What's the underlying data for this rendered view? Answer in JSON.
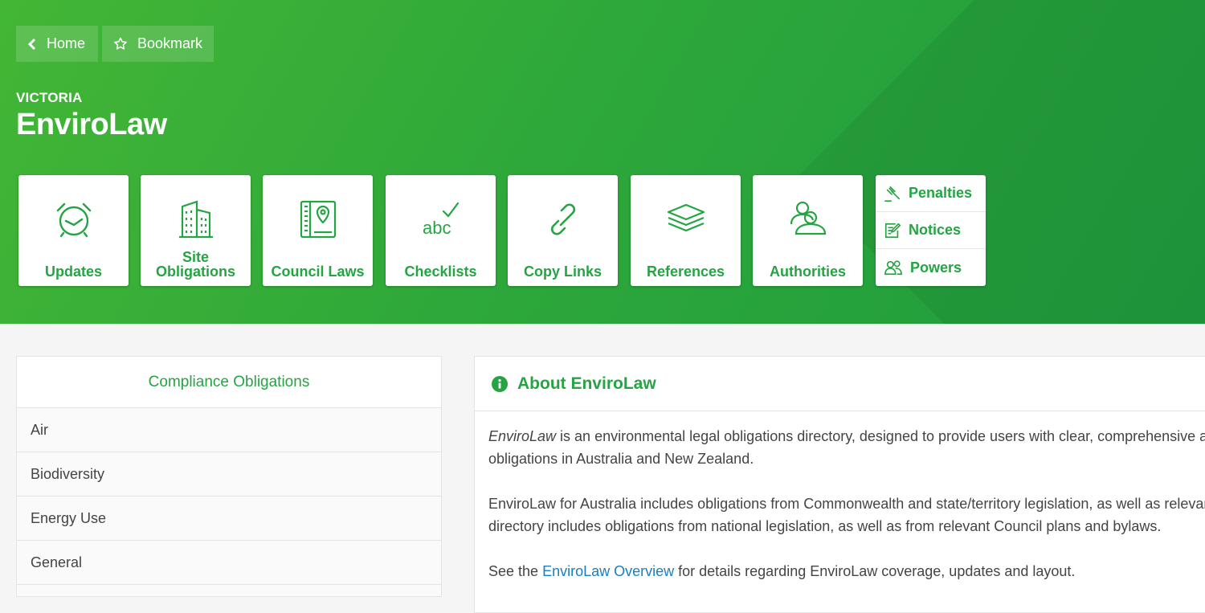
{
  "nav": {
    "home_label": "Home",
    "bookmark_label": "Bookmark"
  },
  "header": {
    "region": "VICTORIA",
    "title": "EnviroLaw"
  },
  "tiles": [
    {
      "label": "Updates",
      "icon": "alarm-clock-icon"
    },
    {
      "label": "Site\nObligations",
      "icon": "building-icon"
    },
    {
      "label": "Council Laws",
      "icon": "map-book-icon"
    },
    {
      "label": "Checklists",
      "icon": "abc-check-icon"
    },
    {
      "label": "Copy Links",
      "icon": "link-icon"
    },
    {
      "label": "References",
      "icon": "layers-icon"
    },
    {
      "label": "Authorities",
      "icon": "people-icon"
    }
  ],
  "mini_tiles": [
    {
      "label": "Penalties",
      "icon": "gavel-icon"
    },
    {
      "label": "Notices",
      "icon": "notice-edit-icon"
    },
    {
      "label": "Powers",
      "icon": "users-icon"
    }
  ],
  "obligations": {
    "title": "Compliance Obligations",
    "items": [
      "Air",
      "Biodiversity",
      "Energy Use",
      "General"
    ]
  },
  "about": {
    "title": "About EnviroLaw",
    "p1_em": "EnviroLaw",
    "p1_line1": " is an environmental legal obligations directory, designed to provide users with clear, comprehensive and",
    "p1_line2": "obligations in Australia and New Zealand.",
    "p2_line1": "EnviroLaw for Australia includes obligations from Commonwealth and state/territory legislation, as well as relevant",
    "p2_line2": "directory includes obligations from national legislation, as well as from relevant Council plans and bylaws.",
    "p3_before": "See the ",
    "p3_link": "EnviroLaw Overview",
    "p3_after": " for details regarding EnviroLaw coverage, updates and layout."
  },
  "colors": {
    "brand_green": "#25a444",
    "hero_start": "#43b635",
    "hero_end": "#1f9c3e",
    "link": "#1a7fbf"
  }
}
